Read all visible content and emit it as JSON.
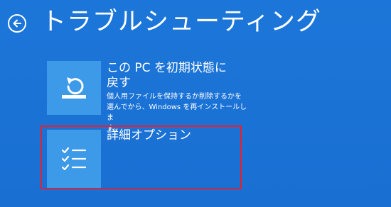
{
  "header": {
    "title": "トラブルシューティング",
    "back_icon": "back-arrow-icon"
  },
  "options": [
    {
      "title": "この PC を初期状態に\n戻す",
      "description": "個人用ファイルを保持するか削除するかを\n選んでから、Windows を再インストールしま\nす。",
      "icon": "reset-pc-icon"
    },
    {
      "title": "詳細オプション",
      "icon": "checklist-icon"
    }
  ],
  "colors": {
    "background": "#1a73d6",
    "tile": "#3d9ae8",
    "highlight": "#e8202e"
  }
}
